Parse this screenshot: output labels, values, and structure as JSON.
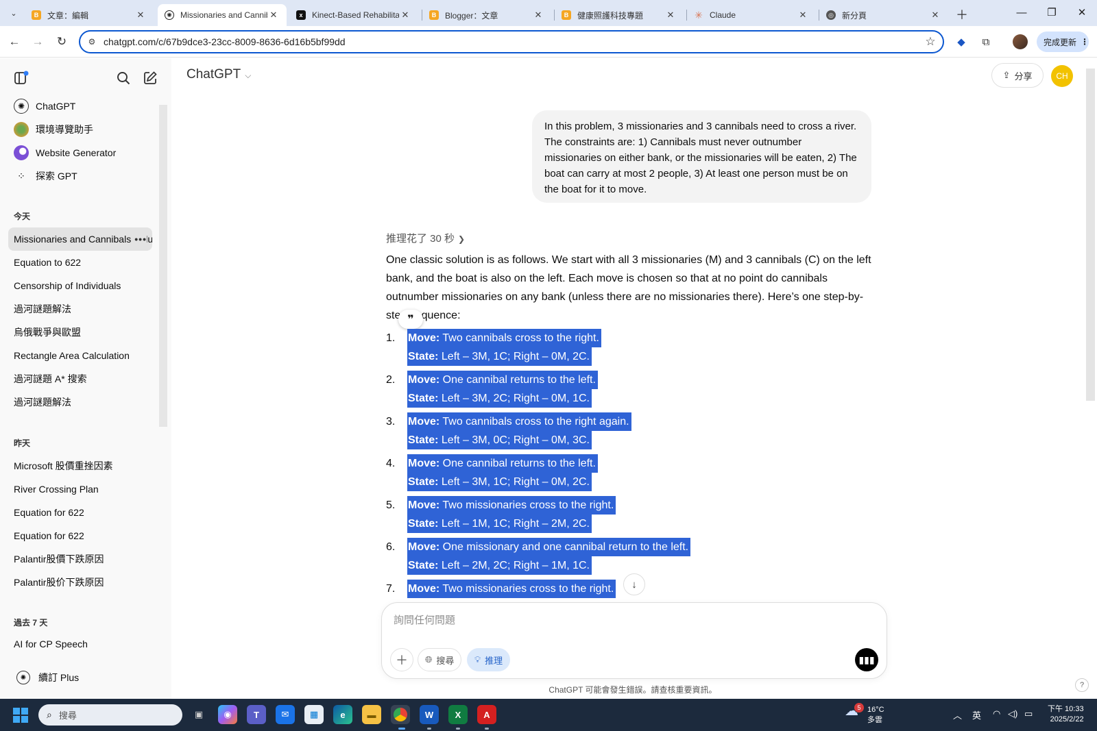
{
  "browser": {
    "tabs": [
      {
        "title": "文章：編輯",
        "favicon": "blogger-icon",
        "color": "#f5a623"
      },
      {
        "title": "Missionaries and Cannibals",
        "favicon": "chatgpt-icon",
        "color": "#222222"
      },
      {
        "title": "Kinect-Based Rehabilitation",
        "favicon": "x-icon",
        "color": "#111111"
      },
      {
        "title": "Blogger：文章",
        "favicon": "blogger-icon",
        "color": "#f5a623"
      },
      {
        "title": "健康照護科技專題",
        "favicon": "blogger-icon",
        "color": "#f5a623"
      },
      {
        "title": "Claude",
        "favicon": "claude-icon",
        "color": "#d97757"
      },
      {
        "title": "新分頁",
        "favicon": "chrome-icon",
        "color": "#555555"
      }
    ],
    "active_tab": 1,
    "url": "chatgpt.com/c/67b9dce3-23cc-8009-8636-6d16b5bf99dd",
    "update_label": "完成更新"
  },
  "sidebar": {
    "gpts": [
      {
        "label": "ChatGPT",
        "icon": "chatgpt-logo-icon"
      },
      {
        "label": "環境導覽助手",
        "icon": "guide-avatar-icon"
      },
      {
        "label": "Website Generator",
        "icon": "website-generator-icon"
      },
      {
        "label": "探索 GPT",
        "icon": "grid-icon"
      }
    ],
    "sections": [
      {
        "header": "今天",
        "items": [
          "Missionaries and Cannibals Solution",
          "Equation to 622",
          "Censorship of Individuals",
          "過河謎題解法",
          "烏俄戰爭與歐盟",
          "Rectangle Area Calculation",
          "過河謎題 A* 搜索",
          "過河謎題解法"
        ]
      },
      {
        "header": "昨天",
        "items": [
          "Microsoft 股價重挫因素",
          "River Crossing Plan",
          "Equation for 622",
          "Equation for 622",
          "Palantir股價下跌原因",
          "Palantir股价下跌原因"
        ]
      },
      {
        "header": "過去 7 天",
        "items": [
          "AI for CP Speech"
        ]
      }
    ],
    "more_glyph": "•••",
    "plus_label": "續訂 Plus"
  },
  "header": {
    "title": "ChatGPT",
    "share_label": "分享",
    "avatar_initials": "CH"
  },
  "conversation": {
    "user_message": "In this problem, 3 missionaries and 3 cannibals need to cross a river. The constraints are: 1) Cannibals must never outnumber missionaries on either bank, or the missionaries will be eaten, 2) The boat can carry at most 2 people, 3) At least one person must be on the boat for it to move.",
    "reasoning_label": "推理花了 30 秒",
    "intro": "One classic solution is as follows. We start with all 3 missionaries (M) and 3 cannibals (C) on the left bank, and the boat is also on the left. Each move is chosen so that at no point do cannibals outnumber missionaries on any bank (unless there are no missionaries there). Here’s one step-by-step sequence:",
    "move_label": "Move:",
    "state_label": "State:",
    "steps": [
      {
        "num": "1.",
        "move": " Two cannibals cross to the right.",
        "state": " Left – 3M, 1C; Right – 0M, 2C."
      },
      {
        "num": "2.",
        "move": " One cannibal returns to the left.",
        "state": " Left – 3M, 2C; Right – 0M, 1C."
      },
      {
        "num": "3.",
        "move": " Two cannibals cross to the right again.",
        "state": " Left – 3M, 0C; Right – 0M, 3C."
      },
      {
        "num": "4.",
        "move": " One cannibal returns to the left.",
        "state": " Left – 3M, 1C; Right – 0M, 2C."
      },
      {
        "num": "5.",
        "move": " Two missionaries cross to the right.",
        "state": " Left – 1M, 1C; Right – 2M, 2C."
      },
      {
        "num": "6.",
        "move": " One missionary and one cannibal return to the left.",
        "state": " Left – 2M, 2C; Right – 1M, 1C."
      },
      {
        "num": "7.",
        "move": " Two missionaries cross to the right.",
        "state": ""
      }
    ]
  },
  "composer": {
    "placeholder": "詢問任何問題",
    "search_label": "搜尋",
    "reason_label": "推理"
  },
  "disclaimer": "ChatGPT 可能會發生錯誤。請查核重要資訊。",
  "taskbar": {
    "search_placeholder": "搜尋",
    "weather_temp": "16°C",
    "weather_desc": "多雲",
    "weather_badge": "5",
    "ime": "英",
    "time": "下午 10:33",
    "date": "2025/2/22"
  },
  "colors": {
    "selection": "#2f63d6",
    "accent": "#0b57d0",
    "sidebar_bg": "#f9f9f9"
  }
}
